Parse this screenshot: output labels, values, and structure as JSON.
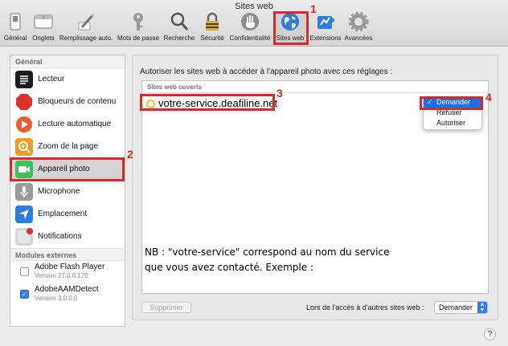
{
  "window": {
    "title": "Sites web"
  },
  "toolbar": {
    "items": [
      {
        "label": "Général",
        "icon": "switch-icon"
      },
      {
        "label": "Onglets",
        "icon": "tabs-icon"
      },
      {
        "label": "Remplissage auto.",
        "icon": "pencil-icon"
      },
      {
        "label": "Mots de passe",
        "icon": "key-icon"
      },
      {
        "label": "Recherche",
        "icon": "magnifier-icon"
      },
      {
        "label": "Sécurité",
        "icon": "lock-icon"
      },
      {
        "label": "Confidentialité",
        "icon": "hand-icon"
      },
      {
        "label": "Sites web",
        "icon": "globe-icon"
      },
      {
        "label": "Extensions",
        "icon": "puzzle-icon"
      },
      {
        "label": "Avancées",
        "icon": "gear-icon"
      }
    ],
    "selected": "Sites web"
  },
  "sidebar": {
    "general_header": "Général",
    "items": [
      {
        "label": "Lecteur",
        "icon": "reader-icon",
        "color": "#1c1c1c"
      },
      {
        "label": "Bloqueurs de contenu",
        "icon": "stop-icon",
        "color": "#e0302b"
      },
      {
        "label": "Lecture automatique",
        "icon": "play-icon",
        "color": "#ef5a2a"
      },
      {
        "label": "Zoom de la page",
        "icon": "zoom-icon",
        "color": "#f19a24"
      },
      {
        "label": "Appareil photo",
        "icon": "camera-icon",
        "color": "#3bc15a"
      },
      {
        "label": "Microphone",
        "icon": "microphone-icon",
        "color": "#9a9a9a"
      },
      {
        "label": "Emplacement",
        "icon": "location-icon",
        "color": "#2b7de1"
      },
      {
        "label": "Notifications",
        "icon": "notifications-icon",
        "color": "#c9c9c9"
      }
    ],
    "selected": "Appareil photo",
    "plugins_header": "Modules externes",
    "plugins": [
      {
        "name": "Adobe Flash Player",
        "version": "Version 27.0.0.170",
        "checked": false
      },
      {
        "name": "AdobeAAMDetect",
        "version": "Version 3.0.0.0",
        "checked": true
      }
    ]
  },
  "main": {
    "prompt": "Autoriser les sites web à accéder à l'appareil photo avec ces réglages :",
    "list_header": "Sites web ouverts",
    "site": "votre-service.deafiline.net",
    "dropdown_options": [
      "Demander",
      "Refuser",
      "Autoriser"
    ],
    "dropdown_selected": "Demander",
    "note_line1": "NB : \"votre-service\" correspond au nom du service",
    "note_line2": "que vous avez contacté. Exemple :",
    "delete_button": "Supprimer",
    "other_sites_label": "Lors de l'accès à d'autres sites web :",
    "other_sites_value": "Demander",
    "help": "?"
  },
  "annotations": [
    "1",
    "2",
    "3",
    "4"
  ],
  "colors": {
    "annotation": "#d62a2a",
    "selection": "#1e6ff0"
  }
}
